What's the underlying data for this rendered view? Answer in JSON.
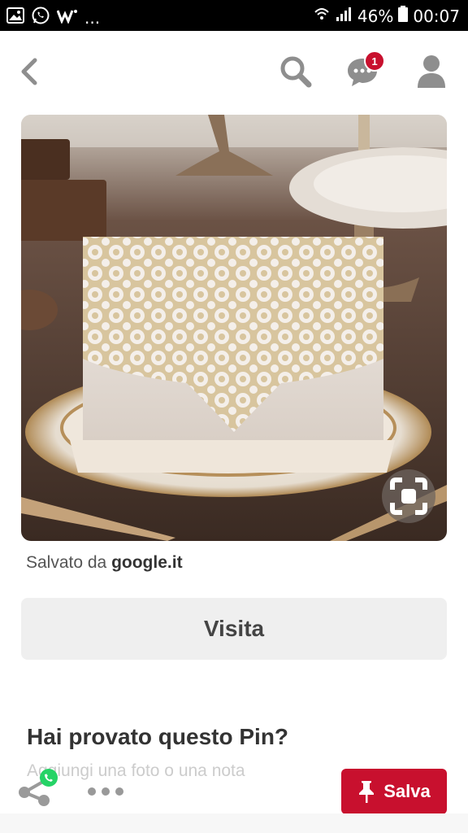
{
  "status_bar": {
    "notifications_more": "...",
    "battery": "46%",
    "time": "00:07"
  },
  "nav": {
    "messages_badge": "1"
  },
  "pin": {
    "saved_from_prefix": "Salvato da ",
    "saved_from_domain": "google.it"
  },
  "actions": {
    "visit_label": "Visita",
    "save_label": "Salva"
  },
  "tried": {
    "title": "Hai provato questo Pin?",
    "subtitle": "Aggiungi una foto o una nota"
  },
  "colors": {
    "brand_red": "#c8102e",
    "button_gray": "#efefef"
  }
}
